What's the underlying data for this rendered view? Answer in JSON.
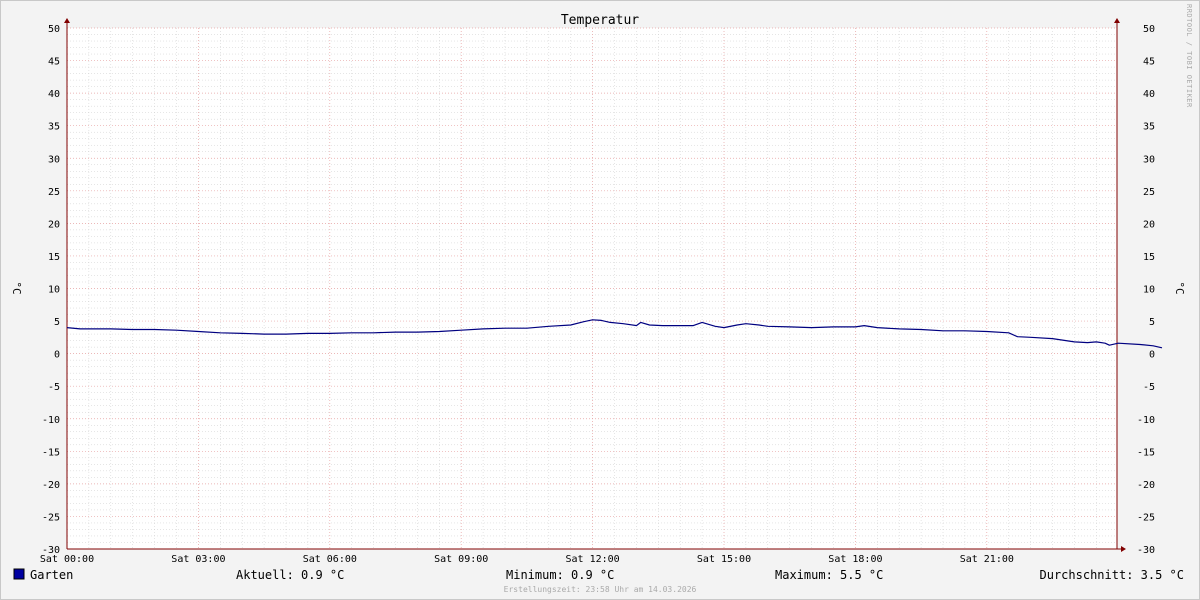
{
  "chart_data": {
    "type": "line",
    "title": "Temperatur",
    "ylabel": "°C",
    "ylim": [
      -30,
      50
    ],
    "y_ticks": [
      50,
      45,
      40,
      35,
      30,
      25,
      20,
      15,
      10,
      5,
      0,
      -5,
      -10,
      -15,
      -20,
      -25,
      -30
    ],
    "xlim_hours": [
      0,
      24
    ],
    "x_ticks": [
      {
        "hour": 0,
        "label": "Sat 00:00"
      },
      {
        "hour": 3,
        "label": "Sat 03:00"
      },
      {
        "hour": 6,
        "label": "Sat 06:00"
      },
      {
        "hour": 9,
        "label": "Sat 09:00"
      },
      {
        "hour": 12,
        "label": "Sat 12:00"
      },
      {
        "hour": 15,
        "label": "Sat 15:00"
      },
      {
        "hour": 18,
        "label": "Sat 18:00"
      },
      {
        "hour": 21,
        "label": "Sat 21:00"
      }
    ],
    "grid": true,
    "series": [
      {
        "name": "Garten",
        "color": "#000080",
        "points": [
          [
            0.0,
            4.0
          ],
          [
            0.3,
            3.8
          ],
          [
            1.0,
            3.8
          ],
          [
            1.5,
            3.7
          ],
          [
            2.0,
            3.7
          ],
          [
            2.5,
            3.6
          ],
          [
            3.0,
            3.4
          ],
          [
            3.5,
            3.2
          ],
          [
            4.0,
            3.1
          ],
          [
            4.5,
            3.0
          ],
          [
            5.0,
            3.0
          ],
          [
            5.5,
            3.1
          ],
          [
            6.0,
            3.1
          ],
          [
            6.5,
            3.2
          ],
          [
            7.0,
            3.2
          ],
          [
            7.5,
            3.3
          ],
          [
            8.0,
            3.3
          ],
          [
            8.5,
            3.4
          ],
          [
            9.0,
            3.6
          ],
          [
            9.5,
            3.8
          ],
          [
            10.0,
            3.9
          ],
          [
            10.5,
            3.9
          ],
          [
            11.0,
            4.2
          ],
          [
            11.5,
            4.4
          ],
          [
            11.8,
            4.9
          ],
          [
            12.0,
            5.2
          ],
          [
            12.2,
            5.1
          ],
          [
            12.4,
            4.8
          ],
          [
            12.7,
            4.6
          ],
          [
            13.0,
            4.3
          ],
          [
            13.1,
            4.8
          ],
          [
            13.3,
            4.4
          ],
          [
            13.6,
            4.3
          ],
          [
            14.0,
            4.3
          ],
          [
            14.3,
            4.3
          ],
          [
            14.5,
            4.8
          ],
          [
            14.8,
            4.2
          ],
          [
            15.0,
            4.0
          ],
          [
            15.3,
            4.4
          ],
          [
            15.5,
            4.6
          ],
          [
            15.8,
            4.4
          ],
          [
            16.0,
            4.2
          ],
          [
            16.5,
            4.1
          ],
          [
            17.0,
            4.0
          ],
          [
            17.5,
            4.1
          ],
          [
            18.0,
            4.1
          ],
          [
            18.2,
            4.3
          ],
          [
            18.5,
            4.0
          ],
          [
            19.0,
            3.8
          ],
          [
            19.5,
            3.7
          ],
          [
            20.0,
            3.5
          ],
          [
            20.5,
            3.5
          ],
          [
            21.0,
            3.4
          ],
          [
            21.5,
            3.2
          ],
          [
            21.7,
            2.6
          ],
          [
            22.0,
            2.5
          ],
          [
            22.5,
            2.3
          ],
          [
            23.0,
            1.8
          ],
          [
            23.3,
            1.7
          ],
          [
            23.5,
            1.8
          ],
          [
            23.7,
            1.6
          ],
          [
            23.8,
            1.3
          ],
          [
            24.0,
            1.6
          ],
          [
            24.5,
            1.4
          ],
          [
            24.8,
            1.2
          ],
          [
            25.0,
            0.9
          ]
        ]
      }
    ]
  },
  "legend": {
    "series_name": "Garten",
    "swatch_color": "#0000a0",
    "aktuell": "Aktuell: 0.9 °C",
    "minimum": "Minimum: 0.9 °C",
    "maximum": "Maximum: 5.5 °C",
    "durchschnitt": "Durchschnitt: 3.5 °C"
  },
  "watermark": "RRDTOOL / TOBI OETIKER",
  "footer": "Erstellungszeit: 23:58 Uhr am 14.03.2026",
  "colors": {
    "plot_bg": "#ffffff",
    "grid_minor": "#cccccc",
    "grid_major": "#e6a0a0",
    "axis": "#800000",
    "line": "#000080"
  }
}
